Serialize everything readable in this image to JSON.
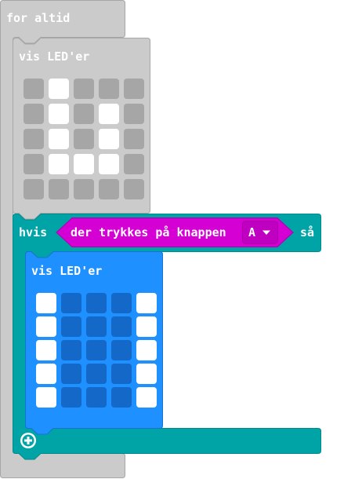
{
  "colors": {
    "forever_block": "#cbcbcb",
    "forever_border": "#a6a6a6",
    "show_leds_gray": "#cbcbcb",
    "show_leds_gray_border": "#a6a6a6",
    "led_off_gray": "#a6a6a6",
    "led_on": "#ffffff",
    "if_block": "#00a4a6",
    "if_block_border": "#008a8c",
    "button_pressed_block": "#d400d4",
    "button_pressed_border": "#a800a8",
    "dropdown_bg": "#c000c0",
    "show_leds_blue": "#1e90ff",
    "show_leds_blue_border": "#1873cc",
    "led_off_blue": "#1368c8"
  },
  "forever": {
    "label": "for altid"
  },
  "show_leds_1": {
    "label": "vis LED'er",
    "leds": [
      [
        0,
        1,
        0,
        0,
        0
      ],
      [
        0,
        1,
        0,
        1,
        0
      ],
      [
        0,
        1,
        0,
        1,
        0
      ],
      [
        0,
        1,
        1,
        1,
        0
      ],
      [
        0,
        0,
        0,
        0,
        0
      ]
    ]
  },
  "if_block": {
    "label_if": "hvis",
    "label_then": "så",
    "add_icon": "plus-circle-icon"
  },
  "button_pressed": {
    "label": "der trykkes på knappen",
    "button_value": "A",
    "dropdown_icon": "caret-down-icon"
  },
  "show_leds_2": {
    "label": "vis LED'er",
    "leds": [
      [
        1,
        0,
        0,
        0,
        1
      ],
      [
        1,
        0,
        0,
        0,
        1
      ],
      [
        1,
        0,
        0,
        0,
        1
      ],
      [
        1,
        0,
        0,
        0,
        1
      ],
      [
        1,
        0,
        0,
        0,
        1
      ]
    ]
  }
}
